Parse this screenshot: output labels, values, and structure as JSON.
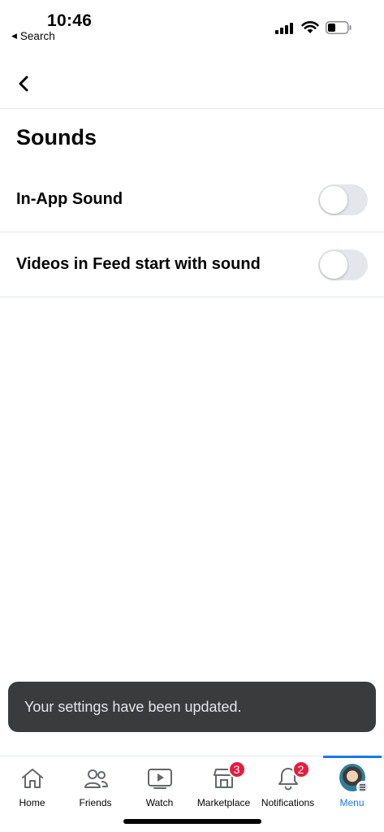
{
  "status_bar": {
    "time": "10:46",
    "back_label": "Search"
  },
  "page": {
    "title": "Sounds"
  },
  "settings": [
    {
      "label": "In-App Sound",
      "enabled": false
    },
    {
      "label": "Videos in Feed start with sound",
      "enabled": false
    }
  ],
  "toast": {
    "message": "Your settings have been updated."
  },
  "tab_bar": {
    "tabs": [
      {
        "label": "Home",
        "icon": "home-icon"
      },
      {
        "label": "Friends",
        "icon": "friends-icon"
      },
      {
        "label": "Watch",
        "icon": "watch-icon"
      },
      {
        "label": "Marketplace",
        "icon": "marketplace-icon",
        "badge": "3"
      },
      {
        "label": "Notifications",
        "icon": "bell-icon",
        "badge": "2"
      },
      {
        "label": "Menu",
        "icon": "avatar",
        "active": true
      }
    ]
  },
  "colors": {
    "accent": "#1877f2",
    "badge": "#e41e3f",
    "toast_bg": "#3a3b3c",
    "toggle_off": "#e4e6eb"
  }
}
